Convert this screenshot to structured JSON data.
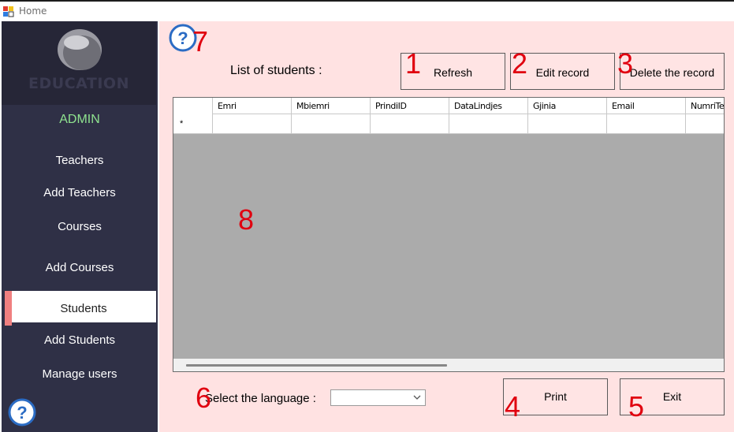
{
  "window": {
    "title": "Home"
  },
  "sidebar": {
    "logo_text": "EDUCATION",
    "role": "ADMIN",
    "items": [
      {
        "label": "Teachers"
      },
      {
        "label": "Add Teachers"
      },
      {
        "label": "Courses"
      },
      {
        "label": "Add Courses"
      },
      {
        "label": "Students",
        "active": true
      },
      {
        "label": "Add Students"
      },
      {
        "label": "Manage users"
      }
    ]
  },
  "main": {
    "list_title": "List of students :",
    "buttons": {
      "refresh": "Refresh",
      "edit": "Edit record",
      "delete": "Delete the record",
      "print": "Print",
      "exit": "Exit"
    },
    "grid": {
      "columns": [
        "Emri",
        "Mbiemri",
        "PrindiID",
        "DataLindjes",
        "Gjinia",
        "Email",
        "NumriTe"
      ],
      "new_row_marker": "*"
    },
    "language": {
      "label": "Select the language :",
      "value": ""
    }
  },
  "annotations": [
    "1",
    "2",
    "3",
    "4",
    "5",
    "6",
    "7",
    "8"
  ],
  "colors": {
    "sidebar_bg": "#2f3046",
    "main_bg": "#ffe2e2",
    "admin_text": "#8fe38f",
    "active_marker": "#f08080",
    "annotation": "#e0000f",
    "help_icon": "#2b6cc4"
  }
}
